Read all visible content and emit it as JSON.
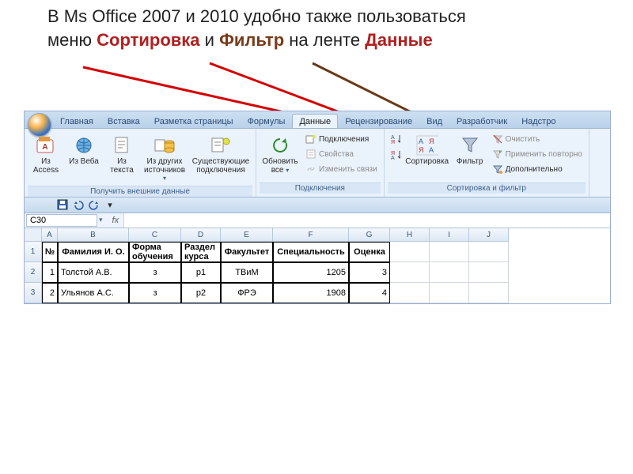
{
  "caption": {
    "line1_a": "В Ms Office 2007 и 2010 удобно также пользоваться",
    "line2_a": "меню ",
    "line2_sort": "Сортировка",
    "line2_and": " и ",
    "line2_filter": "Фильтр",
    "line2_on": " на ленте ",
    "line2_data": "Данные"
  },
  "tabs": [
    "Главная",
    "Вставка",
    "Разметка страницы",
    "Формулы",
    "Данные",
    "Рецензирование",
    "Вид",
    "Разработчик",
    "Надстро"
  ],
  "tabs_active_index": 4,
  "ribbon": {
    "group_getdata": {
      "label": "Получить внешние данные",
      "access": "Из\nAccess",
      "web": "Из\nВеба",
      "text": "Из\nтекста",
      "other": "Из других\nисточников",
      "existing": "Существующие\nподключения"
    },
    "group_conn": {
      "label": "Подключения",
      "refresh": "Обновить\nвсе",
      "connections": "Подключения",
      "properties": "Свойства",
      "editlinks": "Изменить связи"
    },
    "group_sort": {
      "label": "Сортировка и фильтр",
      "sort": "Сортировка",
      "filter": "Фильтр",
      "clear": "Очистить",
      "reapply": "Применить повторно",
      "advanced": "Дополнительно"
    }
  },
  "namebox": "C30",
  "grid": {
    "cols": [
      "A",
      "B",
      "C",
      "D",
      "E",
      "F",
      "G",
      "H",
      "I",
      "J"
    ],
    "header": [
      "№",
      "Фамилия И. О.",
      "Форма обучения",
      "Раздел курса",
      "Факультет",
      "Специальность",
      "Оценка"
    ],
    "rows": [
      [
        "1",
        "Толстой А.В.",
        "з",
        "р1",
        "ТВиМ",
        "1205",
        "3"
      ],
      [
        "2",
        "Ульянов А.С.",
        "з",
        "р2",
        "ФРЭ",
        "1908",
        "4"
      ]
    ]
  }
}
